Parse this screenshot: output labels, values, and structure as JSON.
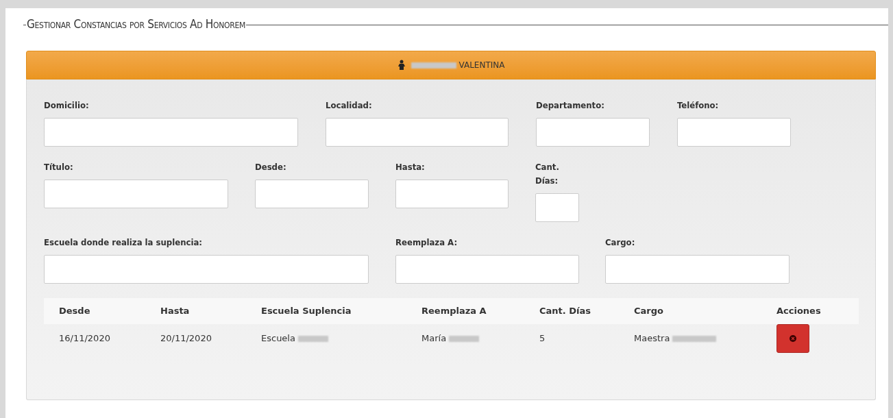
{
  "title": "Gestionar Constancias por Servicios Ad Honorem",
  "person_bar": {
    "name": "VALENTINA"
  },
  "form_rows": [
    [
      {
        "label": "Domicilio:"
      },
      {
        "label": "Localidad:"
      },
      {
        "label": "Departamento:"
      },
      {
        "label": "Teléfono:"
      }
    ],
    [
      {
        "label": "Título:"
      },
      {
        "label": "Desde:"
      },
      {
        "label": "Hasta:"
      },
      {
        "label": "Cant. Días:"
      }
    ],
    [
      {
        "label": "Escuela donde realiza la suplencia:"
      },
      {
        "label": "Reemplaza A:"
      },
      {
        "label": "Cargo:"
      }
    ]
  ],
  "table": {
    "columns": [
      "Desde",
      "Hasta",
      "Escuela Suplencia",
      "Reemplaza A",
      "Cant. Días",
      "Cargo",
      "Acciones"
    ],
    "rows": [
      {
        "cells": [
          "16/11/2020",
          "20/11/2020",
          "Escuela",
          "María",
          "5",
          "Maestra"
        ]
      }
    ]
  }
}
